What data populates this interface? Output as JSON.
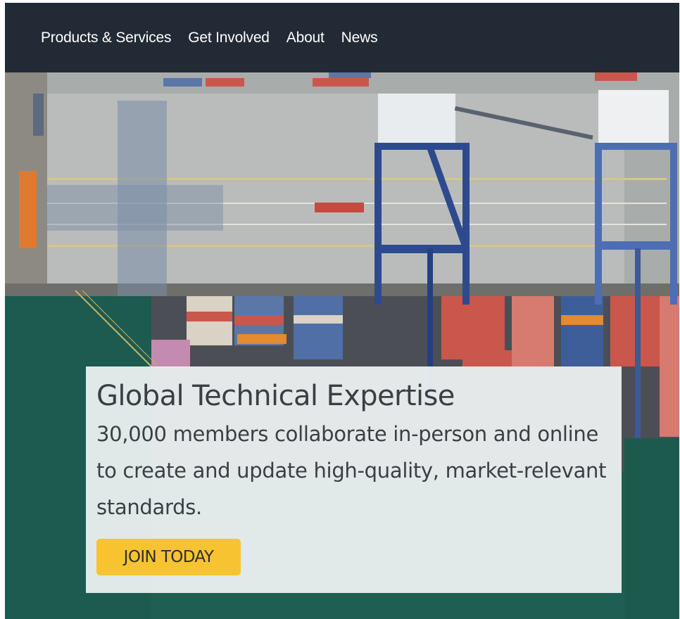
{
  "nav": {
    "items": [
      {
        "label": "Products & Services"
      },
      {
        "label": "Get Involved"
      },
      {
        "label": "About"
      },
      {
        "label": "News"
      }
    ]
  },
  "hero": {
    "title": "Global Technical Expertise",
    "description": "30,000 members collaborate in-person and online to create and update high-quality, market-relevant standards.",
    "cta_label": "JOIN TODAY"
  },
  "colors": {
    "nav_background": "#222a35",
    "cta_background": "#f7c331",
    "water": "#1f5e52",
    "crane_blue": "#2e4a8f"
  }
}
